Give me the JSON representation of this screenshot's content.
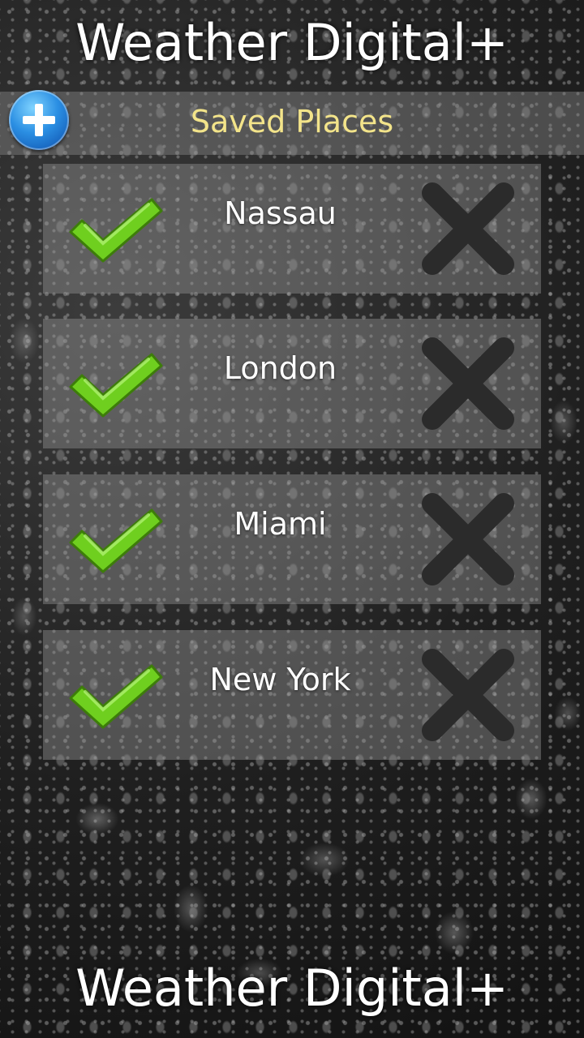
{
  "app": {
    "title_top": "Weather Digital+",
    "title_bottom": "Weather Digital+"
  },
  "header": {
    "label": "Saved Places",
    "label_color": "#f3e48a",
    "add_icon": "plus-icon"
  },
  "places": [
    {
      "name": "Nassau"
    },
    {
      "name": "London"
    },
    {
      "name": "Miami"
    },
    {
      "name": "New York"
    }
  ],
  "icons": {
    "select": "checkmark-icon",
    "delete": "close-x-icon"
  },
  "colors": {
    "check": "#6fcf1f",
    "delete_x": "#2b2b2b",
    "add_button": "#2b8fe3"
  }
}
